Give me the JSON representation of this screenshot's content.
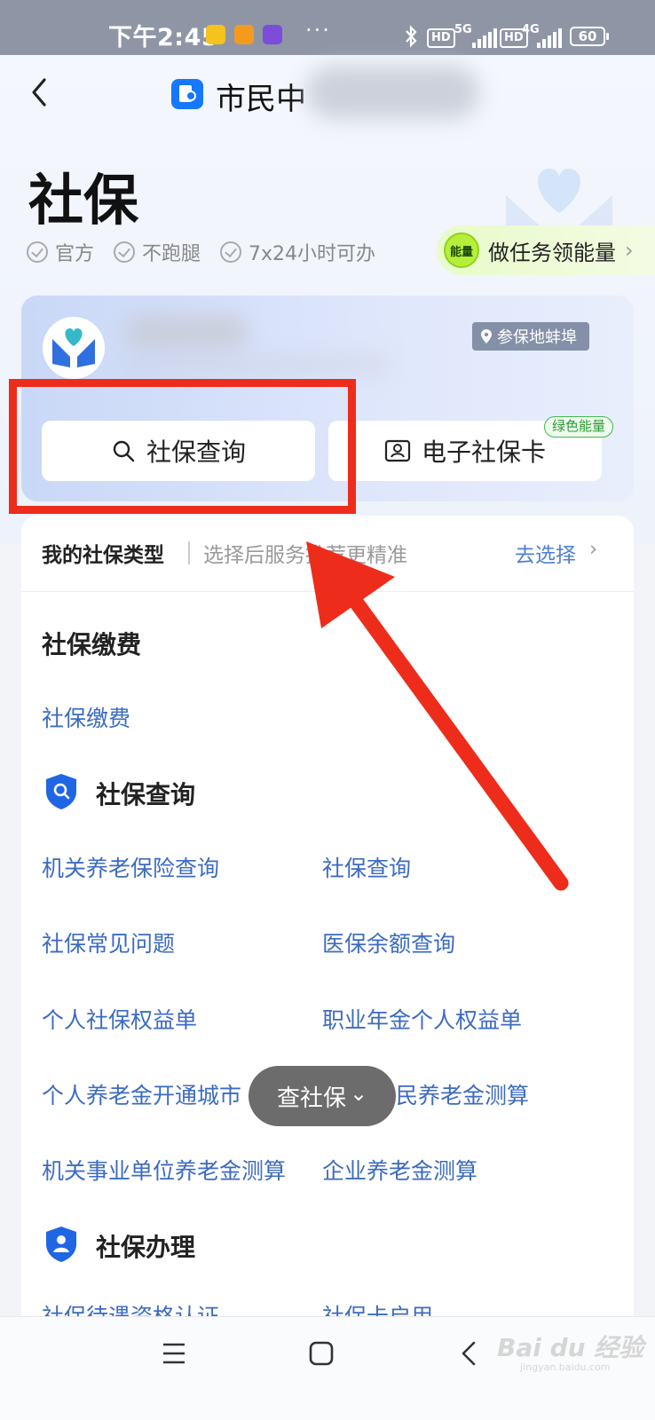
{
  "status_bar": {
    "time": "下午2:45",
    "dots": "···",
    "hd1": "HD",
    "net1": "5G",
    "hd2": "HD",
    "net2": "4G",
    "battery": "60"
  },
  "header": {
    "app_title": "市民中",
    "page_title": "社保",
    "tags": [
      "官方",
      "不跑腿",
      "7x24小时可办"
    ],
    "energy_badge": "能量",
    "energy_text": "做任务领能量",
    "energy_chevron": "›"
  },
  "card": {
    "location": "参保地蚌埠",
    "query_button": "社保查询",
    "card_button": "电子社保卡",
    "green_badge": "绿色能量"
  },
  "type_row": {
    "label": "我的社保类型",
    "hint": "选择后服务推荐更精准",
    "action": "去选择",
    "chevron": "›"
  },
  "sections": {
    "payment": {
      "title": "社保缴费",
      "links": [
        "社保缴费"
      ]
    },
    "query": {
      "title": "社保查询",
      "links": [
        "机关养老保险查询",
        "社保查询",
        "社保常见问题",
        "医保余额查询",
        "个人社保权益单",
        "职业年金个人权益单",
        "个人养老金开通城市",
        "民养老金测算",
        "机关事业单位养老金测算",
        "企业养老金测算"
      ]
    },
    "handle": {
      "title": "社保办理",
      "links": [
        "社保待遇资格认证",
        "社保卡启用"
      ]
    }
  },
  "float_pill": {
    "label": "查社保",
    "chevron": "⌄"
  },
  "watermark": {
    "text": "Bai du 经验",
    "sub": "jingyan.baidu.com"
  },
  "colors": {
    "accent": "#1677ff",
    "link": "#3c6bc1",
    "highlight": "#ee2c1b",
    "energy_green": "#b6ef3a"
  },
  "icons": {
    "back": "chevron-left-icon",
    "search": "search-icon",
    "card": "id-card-icon",
    "location": "location-pin-icon",
    "shield_search": "shield-search-icon",
    "shield_user": "shield-user-icon",
    "menu": "menu-icon",
    "home": "home-icon",
    "nav_back": "nav-back-icon"
  }
}
